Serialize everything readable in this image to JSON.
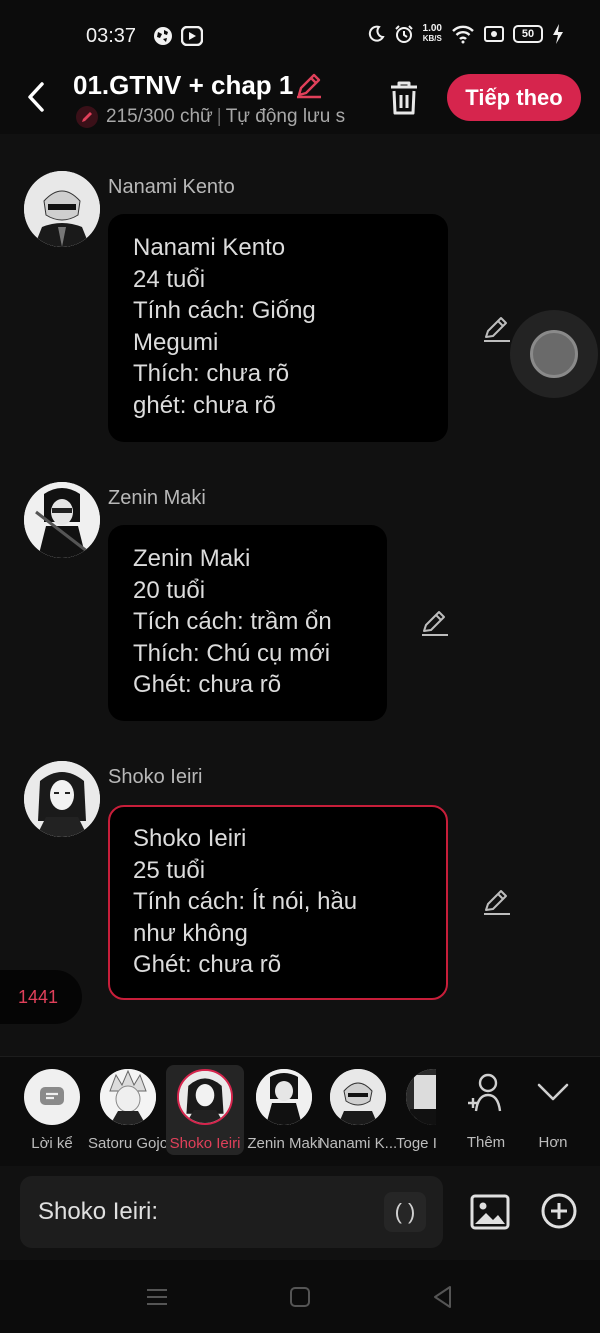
{
  "status_bar": {
    "time": "03:37",
    "speed_value": "1.00",
    "speed_unit": "KB/S",
    "battery": "50"
  },
  "header": {
    "title": "01.GTNV + chap 1",
    "word_count": "215/300 chữ",
    "autosave": "Tự động lưu s",
    "next_label": "Tiếp theo"
  },
  "messages": [
    {
      "name": "Nanami Kento",
      "lines": [
        "Nanami Kento",
        "24 tuổi",
        "Tính cách: Giống",
        "Megumi",
        "Thích: chưa rõ",
        "ghét: chưa rõ"
      ]
    },
    {
      "name": "Zenin Maki",
      "lines": [
        "Zenin Maki",
        "20 tuổi",
        "Tích cách: trầm ổn",
        "Thích: Chú cụ mới",
        "Ghét: chưa rõ"
      ]
    },
    {
      "name": "Shoko Ieiri",
      "lines": [
        "Shoko Ieiri",
        "25 tuổi",
        "Tính cách: Ít nói, hầu",
        "như không",
        "Ghét: chưa rõ"
      ]
    }
  ],
  "word_badge": "1441",
  "characters": [
    {
      "label": "Lời kể",
      "icon": "narration-icon"
    },
    {
      "label": "Satoru Gojo"
    },
    {
      "label": "Shoko Ieiri",
      "selected": true
    },
    {
      "label": "Zenin Maki"
    },
    {
      "label": "Nanami K..."
    },
    {
      "label": "Toge I"
    }
  ],
  "tools": {
    "add_label": "Thêm",
    "more_label": "Hơn"
  },
  "input": {
    "value": "Shoko Ieiri:",
    "paren": "( )"
  },
  "colors": {
    "accent": "#d6254d",
    "background": "#111111",
    "bubble": "#000000"
  }
}
